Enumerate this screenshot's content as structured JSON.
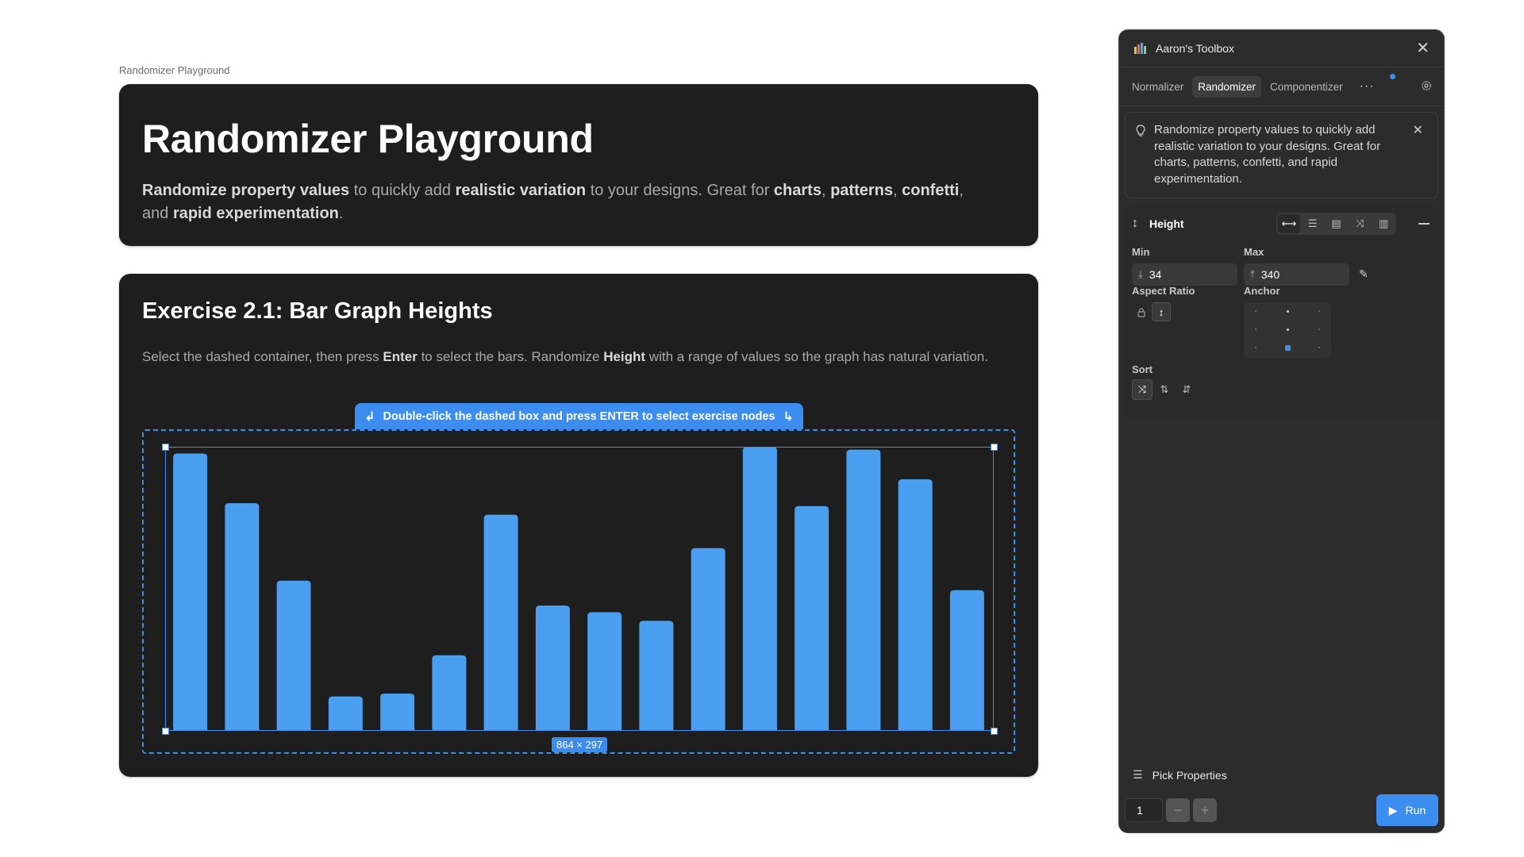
{
  "frame_label": "Randomizer Playground",
  "hero": {
    "title": "Randomizer Playground",
    "desc": [
      {
        "t": "Randomize property values",
        "b": true
      },
      {
        "t": " to quickly add ",
        "b": false
      },
      {
        "t": "realistic variation",
        "b": true
      },
      {
        "t": " to your designs. Great for ",
        "b": false
      },
      {
        "t": "charts",
        "b": true
      },
      {
        "t": ", ",
        "b": false
      },
      {
        "t": "patterns",
        "b": true
      },
      {
        "t": ", ",
        "b": false
      },
      {
        "t": "confetti",
        "b": true
      },
      {
        "t": ", and ",
        "b": false
      },
      {
        "t": "rapid experimentation",
        "b": true
      },
      {
        "t": ".",
        "b": false
      }
    ]
  },
  "exercise": {
    "title": "Exercise 2.1: Bar Graph Heights",
    "desc": [
      {
        "t": "Select the dashed container, then press ",
        "b": false
      },
      {
        "t": "Enter",
        "b": true
      },
      {
        "t": " to select the bars. Randomize ",
        "b": false
      },
      {
        "t": "Height",
        "b": true
      },
      {
        "t": " with a range of values so the graph has natural variation.",
        "b": false
      }
    ],
    "hint": "Double-click the dashed box and press ENTER to select exercise nodes",
    "dimensions": "864 × 297"
  },
  "chart_data": {
    "type": "bar",
    "values": [
      290,
      238,
      157,
      36,
      39,
      79,
      226,
      131,
      124,
      115,
      191,
      297,
      235,
      294,
      263,
      147
    ],
    "ylim": [
      0,
      297
    ],
    "color": "#4a9ff0",
    "grid": false
  },
  "panel": {
    "title": "Aaron's Toolbox",
    "tabs": [
      {
        "label": "Normalizer",
        "active": false
      },
      {
        "label": "Randomizer",
        "active": true
      },
      {
        "label": "Componentizer",
        "active": false
      }
    ],
    "info_text": "Randomize property values to quickly add realistic variation to your designs. Great for charts, patterns, confetti, and rapid experimentation.",
    "property": "Height",
    "min_label": "Min",
    "min_value": "34",
    "max_label": "Max",
    "max_value": "340",
    "aspect_label": "Aspect Ratio",
    "anchor_label": "Anchor",
    "sort_label": "Sort",
    "pick_label": "Pick Properties",
    "count": "1",
    "run_label": "Run",
    "accent": "#3b8df0"
  }
}
